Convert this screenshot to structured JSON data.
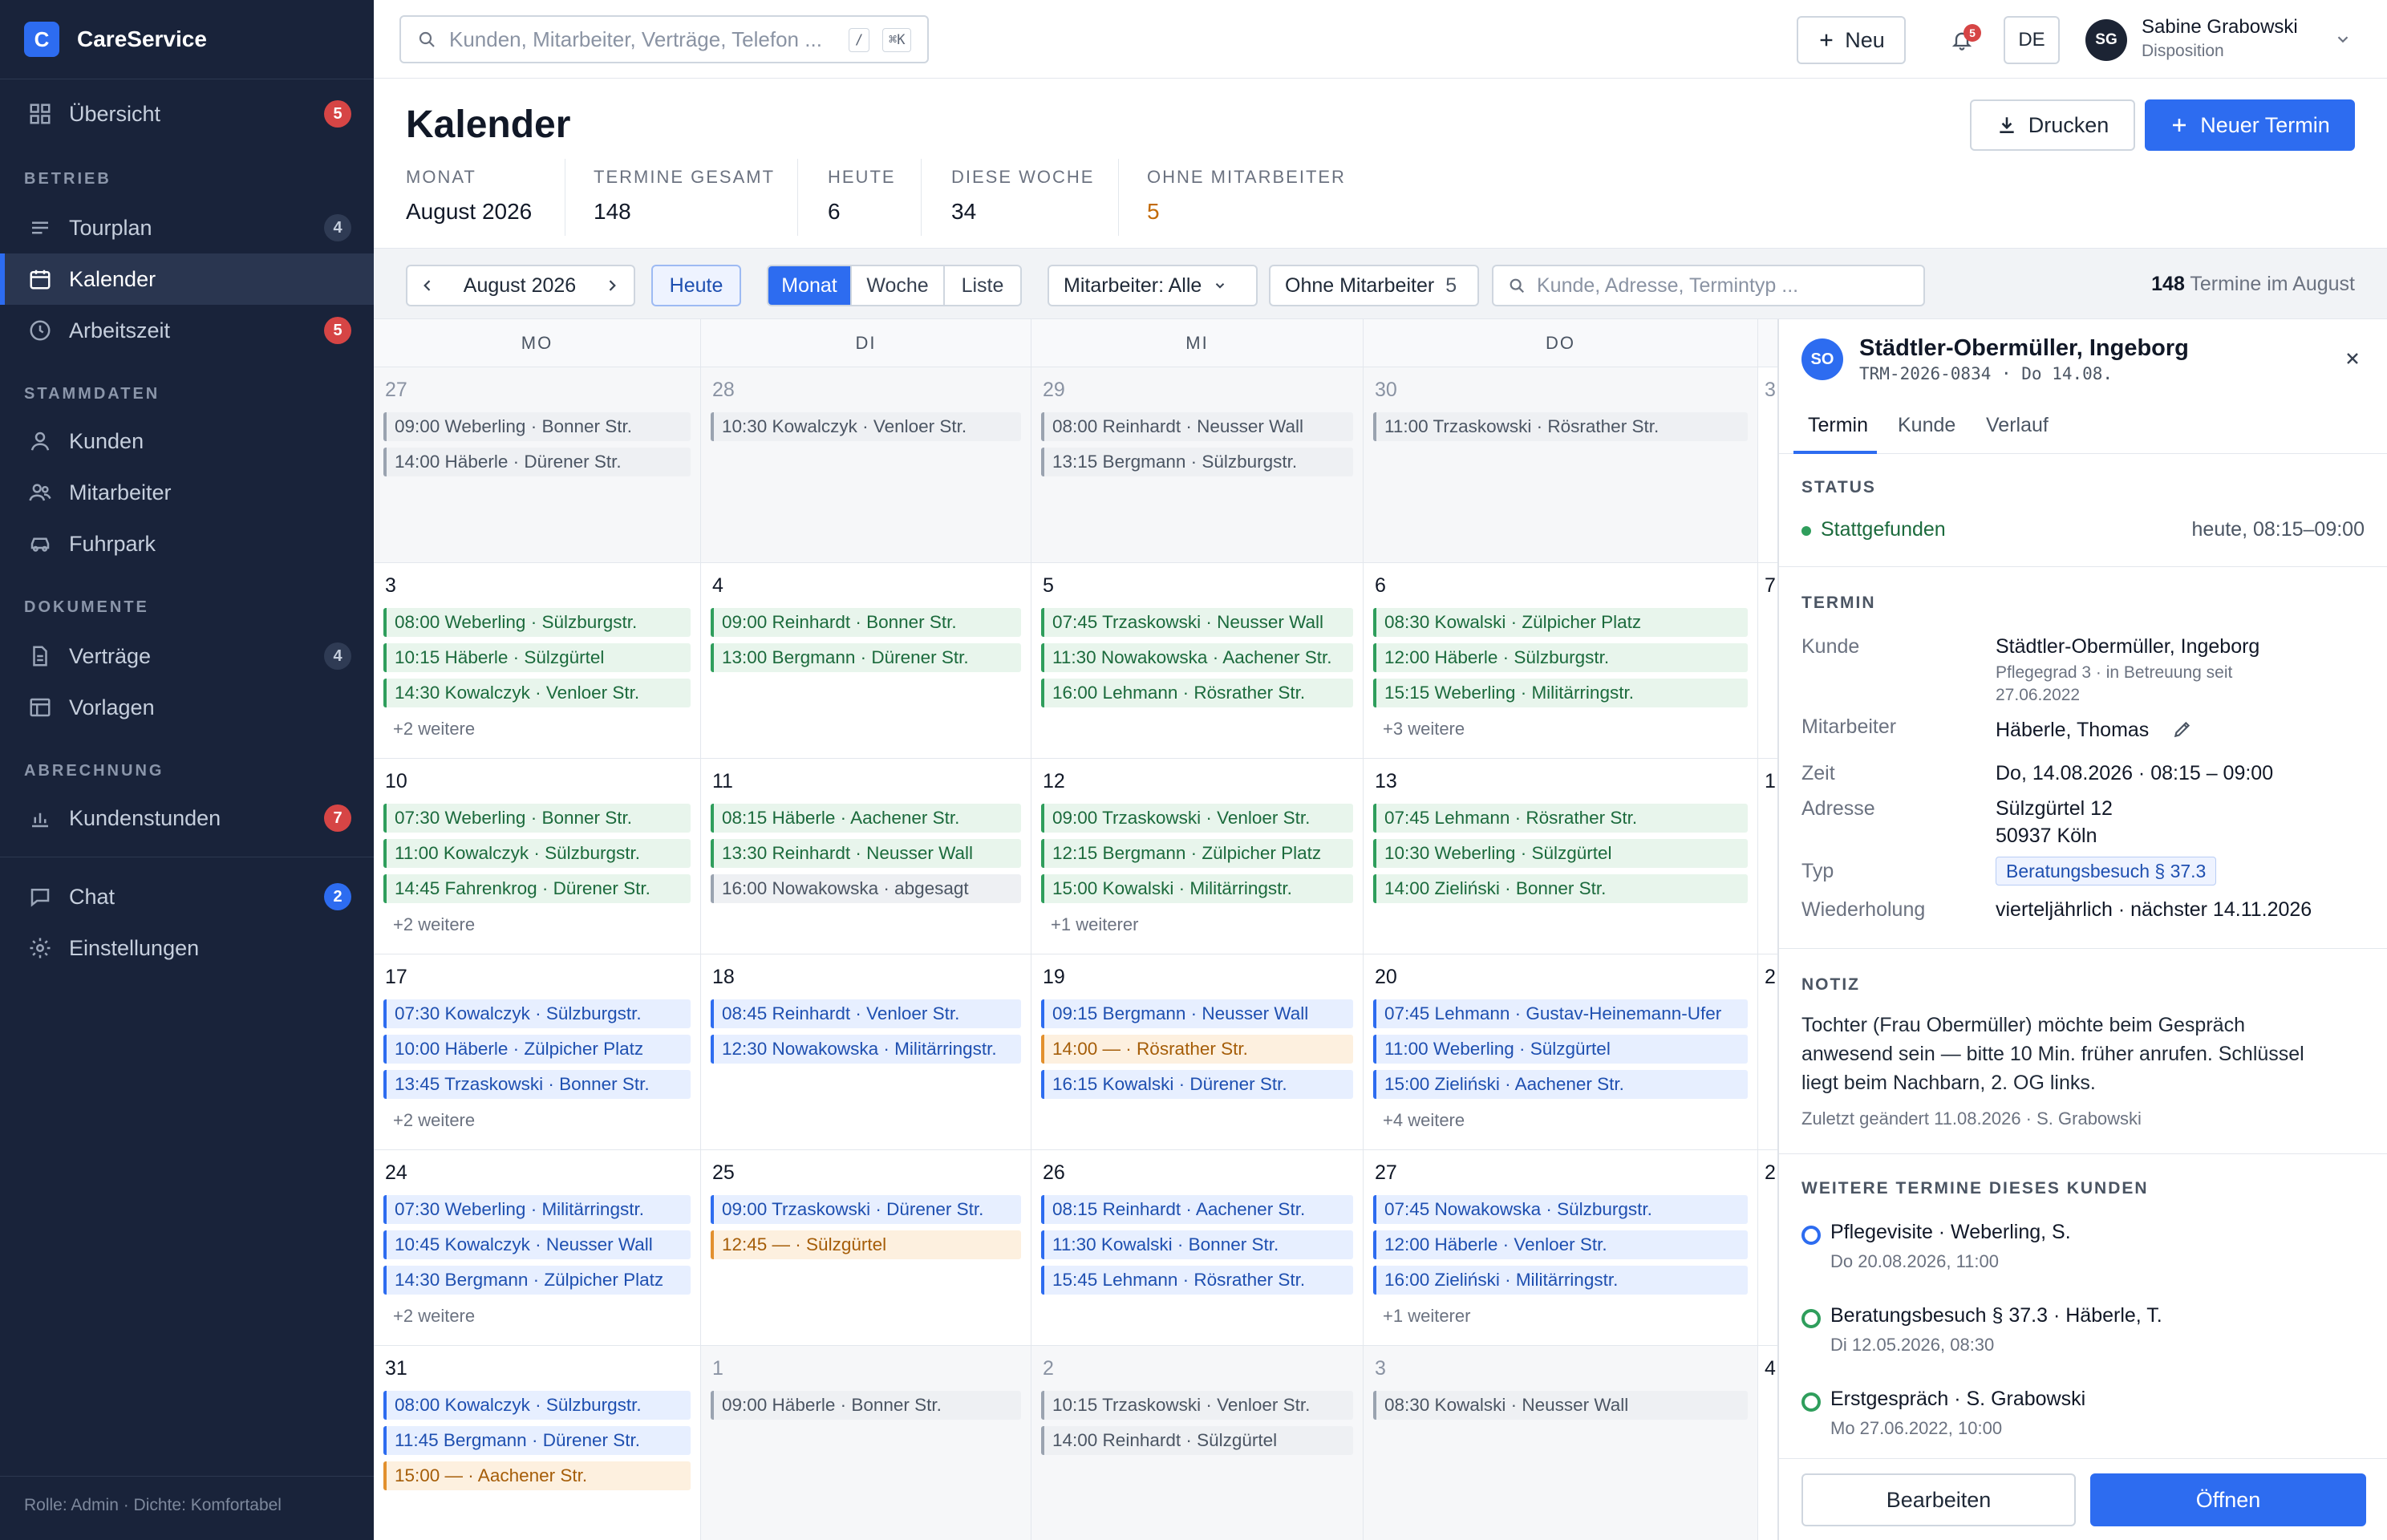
{
  "app": {
    "logo_letter": "C",
    "name": "CareService"
  },
  "sidebar": {
    "overview": {
      "label": "Übersicht",
      "badge": "5"
    },
    "section_betrieb": "BETRIEB",
    "tourplan": {
      "label": "Tourplan",
      "badge": "4"
    },
    "kalender": {
      "label": "Kalender"
    },
    "arbeitszeit": {
      "label": "Arbeitszeit",
      "badge": "5"
    },
    "section_stammdaten": "STAMMDATEN",
    "kunden": {
      "label": "Kunden"
    },
    "mitarbeiter": {
      "label": "Mitarbeiter"
    },
    "fuhrpark": {
      "label": "Fuhrpark"
    },
    "section_dokumente": "DOKUMENTE",
    "vertraege": {
      "label": "Verträge",
      "badge": "4"
    },
    "vorlagen": {
      "label": "Vorlagen"
    },
    "section_abrechnung": "ABRECHNUNG",
    "kundenstunden": {
      "label": "Kundenstunden",
      "badge": "7"
    },
    "chat": {
      "label": "Chat",
      "badge": "2"
    },
    "einstellungen": {
      "label": "Einstellungen"
    },
    "footer": "Rolle: Admin · Dichte: Komfortabel"
  },
  "topbar": {
    "search_placeholder": "Kunden, Mitarbeiter, Verträge, Telefon ...",
    "kbd_slash": "/",
    "kbd_cmd": "⌘K",
    "new_label": "Neu",
    "notif_count": "5",
    "lang": "DE",
    "user_initials": "SG",
    "user_name": "Sabine Grabowski",
    "user_role": "Disposition"
  },
  "page": {
    "title": "Kalender",
    "print_label": "Drucken",
    "new_appt_label": "Neuer Termin",
    "stats": [
      {
        "label": "MONAT",
        "value": "August 2026"
      },
      {
        "label": "TERMINE GESAMT",
        "value": "148"
      },
      {
        "label": "HEUTE",
        "value": "6"
      },
      {
        "label": "DIESE WOCHE",
        "value": "34"
      },
      {
        "label": "OHNE MITARBEITER",
        "value": "5"
      }
    ]
  },
  "toolbar": {
    "month": "August 2026",
    "today": "Heute",
    "views": [
      "Monat",
      "Woche",
      "Liste"
    ],
    "employee_filter": "Mitarbeiter: Alle",
    "unassigned_label": "Ohne Mitarbeiter",
    "unassigned_count": "5",
    "search_placeholder": "Kunde, Adresse, Termintyp ...",
    "summary_count": "148",
    "summary_text": "Termine im August"
  },
  "calendar": {
    "weekdays": [
      "MO",
      "DI",
      "MI",
      "DO"
    ],
    "partial_days": [
      "3",
      "7",
      "1",
      "2",
      "2",
      "4"
    ],
    "weeks": [
      [
        {
          "day": "27",
          "other": true,
          "events": [
            {
              "text": "09:00 Weberling · Bonner Str.",
              "color": "gray"
            },
            {
              "text": "14:00 Häberle · Dürener Str.",
              "color": "gray"
            }
          ],
          "more": ""
        },
        {
          "day": "28",
          "other": true,
          "events": [
            {
              "text": "10:30 Kowalczyk · Venloer Str.",
              "color": "gray"
            }
          ],
          "more": ""
        },
        {
          "day": "29",
          "other": true,
          "events": [
            {
              "text": "08:00 Reinhardt · Neusser Wall",
              "color": "gray"
            },
            {
              "text": "13:15 Bergmann · Sülzburgstr.",
              "color": "gray"
            }
          ],
          "more": ""
        },
        {
          "day": "30",
          "other": true,
          "events": [
            {
              "text": "11:00 Trzaskowski · Rösrather Str.",
              "color": "gray"
            }
          ],
          "more": ""
        }
      ],
      [
        {
          "day": "3",
          "other": false,
          "events": [
            {
              "text": "08:00 Weberling · Sülzburgstr.",
              "color": "green"
            },
            {
              "text": "10:15 Häberle · Sülzgürtel",
              "color": "green"
            },
            {
              "text": "14:30 Kowalczyk · Venloer Str.",
              "color": "green"
            }
          ],
          "more": "+2 weitere"
        },
        {
          "day": "4",
          "other": false,
          "events": [
            {
              "text": "09:00 Reinhardt · Bonner Str.",
              "color": "green"
            },
            {
              "text": "13:00 Bergmann · Dürener Str.",
              "color": "green"
            }
          ],
          "more": ""
        },
        {
          "day": "5",
          "other": false,
          "events": [
            {
              "text": "07:45 Trzaskowski · Neusser Wall",
              "color": "green"
            },
            {
              "text": "11:30 Nowakowska · Aachener Str.",
              "color": "green"
            },
            {
              "text": "16:00 Lehmann · Rösrather Str.",
              "color": "green"
            }
          ],
          "more": ""
        },
        {
          "day": "6",
          "other": false,
          "events": [
            {
              "text": "08:30 Kowalski · Zülpicher Platz",
              "color": "green"
            },
            {
              "text": "12:00 Häberle · Sülzburgstr.",
              "color": "green"
            },
            {
              "text": "15:15 Weberling · Militärringstr.",
              "color": "green"
            }
          ],
          "more": "+3 weitere"
        }
      ],
      [
        {
          "day": "10",
          "other": false,
          "events": [
            {
              "text": "07:30 Weberling · Bonner Str.",
              "color": "green"
            },
            {
              "text": "11:00 Kowalczyk · Sülzburgstr.",
              "color": "green"
            },
            {
              "text": "14:45 Fahrenkrog · Dürener Str.",
              "color": "green"
            }
          ],
          "more": "+2 weitere"
        },
        {
          "day": "11",
          "other": false,
          "events": [
            {
              "text": "08:15 Häberle · Aachener Str.",
              "color": "green"
            },
            {
              "text": "13:30 Reinhardt · Neusser Wall",
              "color": "green"
            },
            {
              "text": "16:00 Nowakowska · abgesagt",
              "color": "gray"
            }
          ],
          "more": ""
        },
        {
          "day": "12",
          "other": false,
          "events": [
            {
              "text": "09:00 Trzaskowski · Venloer Str.",
              "color": "green"
            },
            {
              "text": "12:15 Bergmann · Zülpicher Platz",
              "color": "green"
            },
            {
              "text": "15:00 Kowalski · Militärringstr.",
              "color": "green"
            }
          ],
          "more": "+1 weiterer"
        },
        {
          "day": "13",
          "other": false,
          "events": [
            {
              "text": "07:45 Lehmann · Rösrather Str.",
              "color": "green"
            },
            {
              "text": "10:30 Weberling · Sülzgürtel",
              "color": "green"
            },
            {
              "text": "14:00 Zieliński · Bonner Str.",
              "color": "green"
            }
          ],
          "more": ""
        }
      ],
      [
        {
          "day": "17",
          "other": false,
          "events": [
            {
              "text": "07:30 Kowalczyk · Sülzburgstr.",
              "color": "blue"
            },
            {
              "text": "10:00 Häberle · Zülpicher Platz",
              "color": "blue"
            },
            {
              "text": "13:45 Trzaskowski · Bonner Str.",
              "color": "blue"
            }
          ],
          "more": "+2 weitere"
        },
        {
          "day": "18",
          "other": false,
          "events": [
            {
              "text": "08:45 Reinhardt · Venloer Str.",
              "color": "blue"
            },
            {
              "text": "12:30 Nowakowska · Militärringstr.",
              "color": "blue"
            }
          ],
          "more": ""
        },
        {
          "day": "19",
          "other": false,
          "events": [
            {
              "text": "09:15 Bergmann · Neusser Wall",
              "color": "blue"
            },
            {
              "text": "14:00 — · Rösrather Str.",
              "color": "orange"
            },
            {
              "text": "16:15 Kowalski · Dürener Str.",
              "color": "blue"
            }
          ],
          "more": ""
        },
        {
          "day": "20",
          "other": false,
          "events": [
            {
              "text": "07:45 Lehmann · Gustav-Heinemann-Ufer",
              "color": "blue"
            },
            {
              "text": "11:00 Weberling · Sülzgürtel",
              "color": "blue"
            },
            {
              "text": "15:00 Zieliński · Aachener Str.",
              "color": "blue"
            }
          ],
          "more": "+4 weitere"
        }
      ],
      [
        {
          "day": "24",
          "other": false,
          "events": [
            {
              "text": "07:30 Weberling · Militärringstr.",
              "color": "blue"
            },
            {
              "text": "10:45 Kowalczyk · Neusser Wall",
              "color": "blue"
            },
            {
              "text": "14:30 Bergmann · Zülpicher Platz",
              "color": "blue"
            }
          ],
          "more": "+2 weitere"
        },
        {
          "day": "25",
          "other": false,
          "events": [
            {
              "text": "09:00 Trzaskowski · Dürener Str.",
              "color": "blue"
            },
            {
              "text": "12:45 — · Sülzgürtel",
              "color": "orange"
            }
          ],
          "more": ""
        },
        {
          "day": "26",
          "other": false,
          "events": [
            {
              "text": "08:15 Reinhardt · Aachener Str.",
              "color": "blue"
            },
            {
              "text": "11:30 Kowalski · Bonner Str.",
              "color": "blue"
            },
            {
              "text": "15:45 Lehmann · Rösrather Str.",
              "color": "blue"
            }
          ],
          "more": ""
        },
        {
          "day": "27",
          "other": false,
          "events": [
            {
              "text": "07:45 Nowakowska · Sülzburgstr.",
              "color": "blue"
            },
            {
              "text": "12:00 Häberle · Venloer Str.",
              "color": "blue"
            },
            {
              "text": "16:00 Zieliński · Militärringstr.",
              "color": "blue"
            }
          ],
          "more": "+1 weiterer"
        }
      ],
      [
        {
          "day": "31",
          "other": false,
          "events": [
            {
              "text": "08:00 Kowalczyk · Sülzburgstr.",
              "color": "blue"
            },
            {
              "text": "11:45 Bergmann · Dürener Str.",
              "color": "blue"
            },
            {
              "text": "15:00 — · Aachener Str.",
              "color": "orange"
            }
          ],
          "more": ""
        },
        {
          "day": "1",
          "other": true,
          "events": [
            {
              "text": "09:00 Häberle · Bonner Str.",
              "color": "gray"
            }
          ],
          "more": ""
        },
        {
          "day": "2",
          "other": true,
          "events": [
            {
              "text": "10:15 Trzaskowski · Venloer Str.",
              "color": "gray"
            },
            {
              "text": "14:00 Reinhardt · Sülzgürtel",
              "color": "gray"
            }
          ],
          "more": ""
        },
        {
          "day": "3",
          "other": true,
          "events": [
            {
              "text": "08:30 Kowalski · Neusser Wall",
              "color": "gray"
            }
          ],
          "more": ""
        }
      ]
    ]
  },
  "detail": {
    "initials": "SO",
    "name": "Städtler-Obermüller, Ingeborg",
    "sub": "TRM-2026-0834 · Do 14.08.",
    "tabs": [
      "Termin",
      "Kunde",
      "Verlauf"
    ],
    "status_label": "STATUS",
    "status_value": "Stattgefunden",
    "status_time": "heute, 08:15–09:00",
    "termin_label": "TERMIN",
    "kunde_k": "Kunde",
    "kunde_v": "Städtler-Obermüller, Ingeborg",
    "kunde_sub1": "Pflegegrad 3 · in Betreuung seit",
    "kunde_sub2": "27.06.2022",
    "mitarbeiter_k": "Mitarbeiter",
    "mitarbeiter_v": "Häberle, Thomas",
    "zeit_k": "Zeit",
    "zeit_v": "Do, 14.08.2026 · 08:15 – 09:00",
    "adresse_k": "Adresse",
    "adresse_v1": "Sülzgürtel 12",
    "adresse_v2": "50937 Köln",
    "typ_k": "Typ",
    "typ_v": "Beratungsbesuch § 37.3",
    "wdh_k": "Wiederholung",
    "wdh_v": "vierteljährlich · nächster 14.11.2026",
    "notiz_label": "NOTIZ",
    "notiz_line1": "Tochter (Frau Obermüller) möchte beim Gespräch",
    "notiz_line2": "anwesend sein — bitte 10 Min. früher anrufen. Schlüssel",
    "notiz_line3": "liegt beim Nachbarn, 2. OG links.",
    "notiz_meta": "Zuletzt geändert 11.08.2026 · S. Grabowski",
    "weitere_label": "WEITERE TERMINE DIESES KUNDEN",
    "timeline": [
      {
        "title": "Pflegevisite · Weberling, S.",
        "sub": "Do 20.08.2026, 11:00",
        "color": "#2d6cf0"
      },
      {
        "title": "Beratungsbesuch § 37.3 · Häberle, T.",
        "sub": "Di 12.05.2026, 08:30",
        "color": "#2f9e5c"
      },
      {
        "title": "Erstgespräch · S. Grabowski",
        "sub": "Mo 27.06.2022, 10:00",
        "color": "#2f9e5c"
      }
    ],
    "edit_label": "Bearbeiten",
    "open_label": "Öffnen"
  },
  "colors": {
    "accent": "#2d6cf0",
    "sidebar_bg": "#19233a",
    "success": "#2f9e5c",
    "warning": "#e2902e",
    "danger": "#d64545"
  }
}
